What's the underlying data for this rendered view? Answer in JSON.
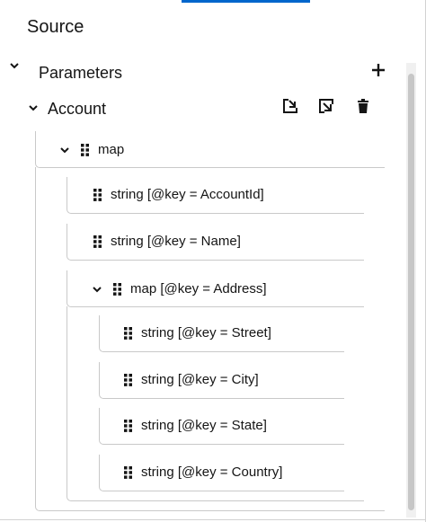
{
  "panel": {
    "title": "Source"
  },
  "parameters": {
    "label": "Parameters"
  },
  "account": {
    "label": "Account"
  },
  "tree": {
    "root": "map",
    "account_id": "string [@key = AccountId]",
    "name": "string [@key = Name]",
    "address": "map [@key = Address]",
    "street": "string [@key = Street]",
    "city": "string [@key = City]",
    "state": "string [@key = State]",
    "country": "string [@key = Country]"
  },
  "icons": {
    "collapse": "chevron-down-icon",
    "add": "plus-icon",
    "import": "import-icon",
    "export": "export-icon",
    "delete": "trash-icon",
    "grip": "grip-vertical-icon"
  }
}
